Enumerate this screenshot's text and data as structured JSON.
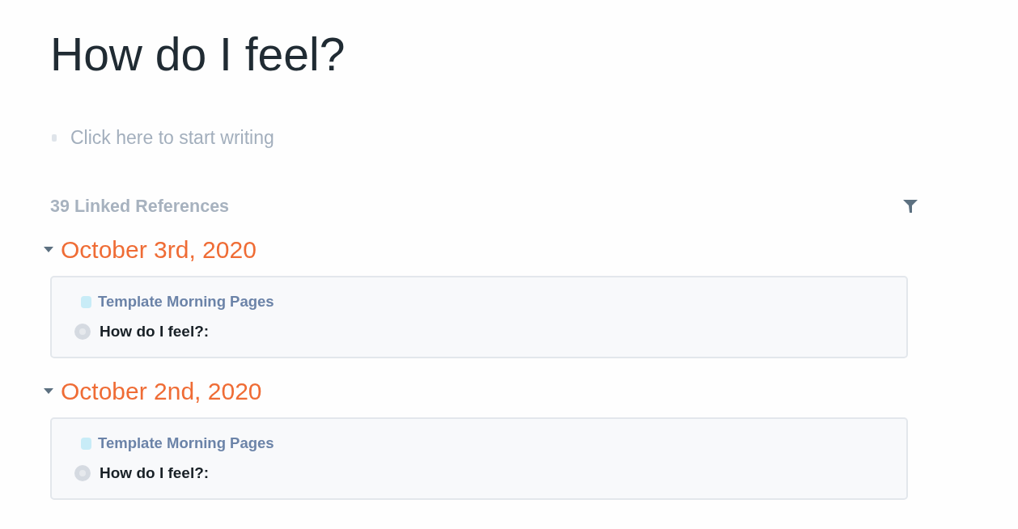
{
  "page": {
    "title": "How do I feel?",
    "placeholder": "Click here to start writing"
  },
  "linked_references": {
    "label": "39 Linked References"
  },
  "groups": [
    {
      "date": "October 3rd, 2020",
      "expanded": true,
      "breadcrumb": "Template Morning Pages",
      "blocks": [
        {
          "text": "How do I feel?:"
        }
      ]
    },
    {
      "date": "October 2nd, 2020",
      "expanded": true,
      "breadcrumb": "Template Morning Pages",
      "blocks": [
        {
          "text": "How do I feel?:"
        }
      ]
    }
  ]
}
